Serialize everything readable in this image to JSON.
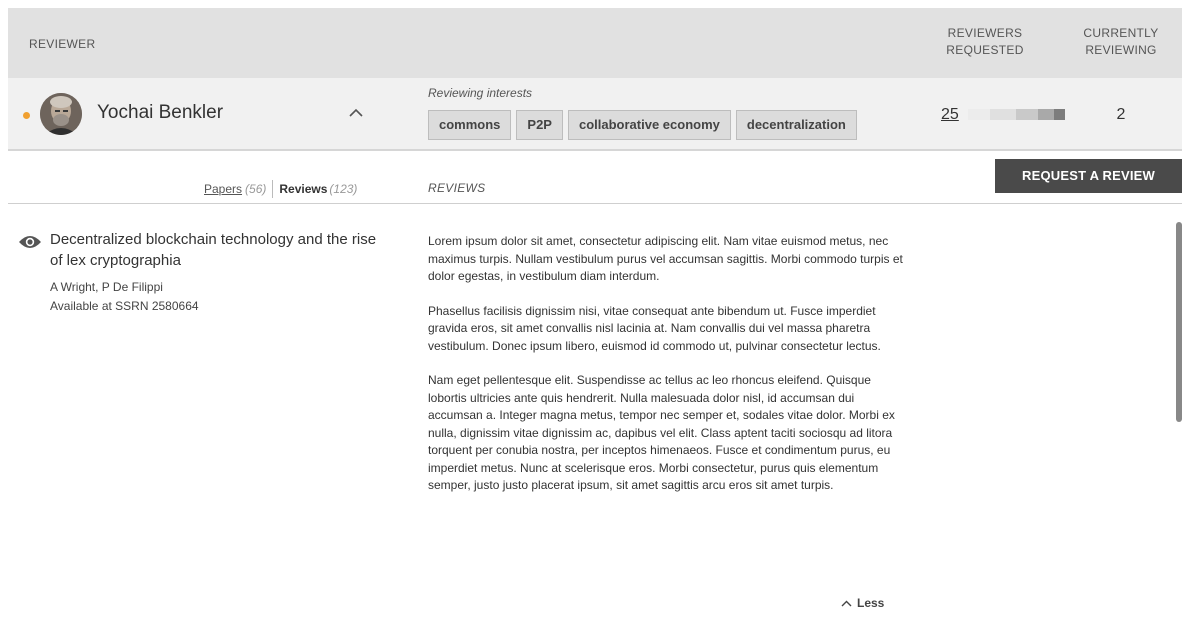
{
  "header": {
    "reviewer": "REVIEWER",
    "reviewers_requested_line1": "REVIEWERS",
    "reviewers_requested_line2": "REQUESTED",
    "currently_reviewing_line1": "CURRENTLY",
    "currently_reviewing_line2": "REVIEWING"
  },
  "reviewer": {
    "name": "Yochai Benkler",
    "status_color": "#f0a030",
    "interests_label": "Reviewing interests",
    "interests": [
      "commons",
      "P2P",
      "collaborative economy",
      "decentralization"
    ],
    "reviewers_requested": "25",
    "currently_reviewing": "2",
    "avatar_icon": "person-photo"
  },
  "tabs": {
    "papers_label": "Papers",
    "papers_count": "(56)",
    "reviews_label": "Reviews",
    "reviews_count": "(123)"
  },
  "reviews_section_label": "REVIEWS",
  "request_button": "REQUEST A REVIEW",
  "paper": {
    "title": "Decentralized blockchain technology and the rise of lex cryptographia",
    "authors": "A Wright, P De Filippi",
    "availability": "Available at SSRN 2580664",
    "icon": "eye-icon"
  },
  "review": {
    "paragraphs": [
      "Lorem ipsum dolor sit amet, consectetur adipiscing elit. Nam vitae euismod metus, nec maximus turpis. Nullam vestibulum purus vel accumsan sagittis. Morbi commodo turpis et dolor egestas, in vestibulum diam interdum.",
      "Phasellus facilisis dignissim nisi, vitae consequat ante bibendum ut. Fusce imperdiet gravida eros, sit amet convallis nisl lacinia at. Nam convallis dui vel massa pharetra vestibulum. Donec ipsum libero, euismod id commodo ut, pulvinar consectetur lectus.",
      "Nam eget pellentesque elit. Suspendisse ac tellus ac leo rhoncus eleifend. Quisque lobortis ultricies ante quis hendrerit. Nulla malesuada dolor nisl, id accumsan dui accumsan a. Integer magna metus, tempor nec semper et, sodales vitae dolor. Morbi ex nulla, dignissim vitae dignissim ac, dapibus vel elit. Class aptent taciti sociosqu ad litora torquent per conubia nostra, per inceptos himenaeos. Fusce et condimentum purus, eu imperdiet metus. Nunc at scelerisque eros. Morbi consectetur, purus quis elementum semper, justo justo placerat ipsum, sit amet sagittis arcu eros sit amet turpis."
    ],
    "less_label": "Less"
  }
}
